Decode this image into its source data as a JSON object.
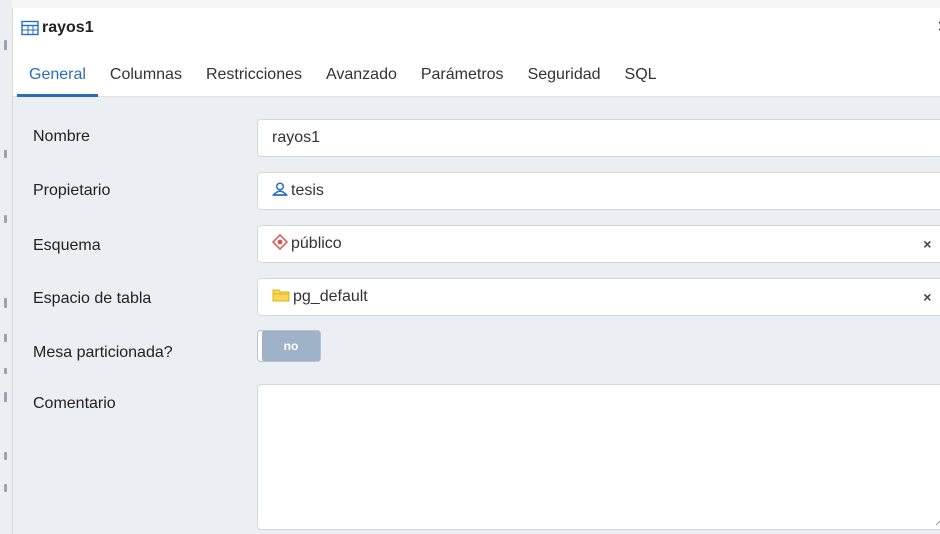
{
  "dialog": {
    "title": "rayos1",
    "title_icon": "table-icon",
    "close_icon": "close-icon"
  },
  "tabs": [
    {
      "label": "General",
      "active": true
    },
    {
      "label": "Columnas",
      "active": false
    },
    {
      "label": "Restricciones",
      "active": false
    },
    {
      "label": "Avanzado",
      "active": false
    },
    {
      "label": "Parámetros",
      "active": false
    },
    {
      "label": "Seguridad",
      "active": false
    },
    {
      "label": "SQL",
      "active": false
    }
  ],
  "form": {
    "nombre": {
      "label": "Nombre",
      "value": "rayos1"
    },
    "propietario": {
      "label": "Propietario",
      "value": "tesis",
      "icon": "user-icon"
    },
    "esquema": {
      "label": "Esquema",
      "value": "público",
      "icon": "schema-icon",
      "clear": "×"
    },
    "espacio": {
      "label": "Espacio de tabla",
      "value": "pg_default",
      "icon": "folder-icon",
      "clear": "×"
    },
    "particionada": {
      "label": "Mesa particionada?",
      "value": "no"
    },
    "comentario": {
      "label": "Comentario",
      "value": ""
    }
  },
  "colors": {
    "accent": "#2a6ebb",
    "toggle_off": "#9fb3c8",
    "form_bg": "#ebeef2",
    "schema_icon": "#d9534f",
    "folder_icon": "#f0c419"
  }
}
